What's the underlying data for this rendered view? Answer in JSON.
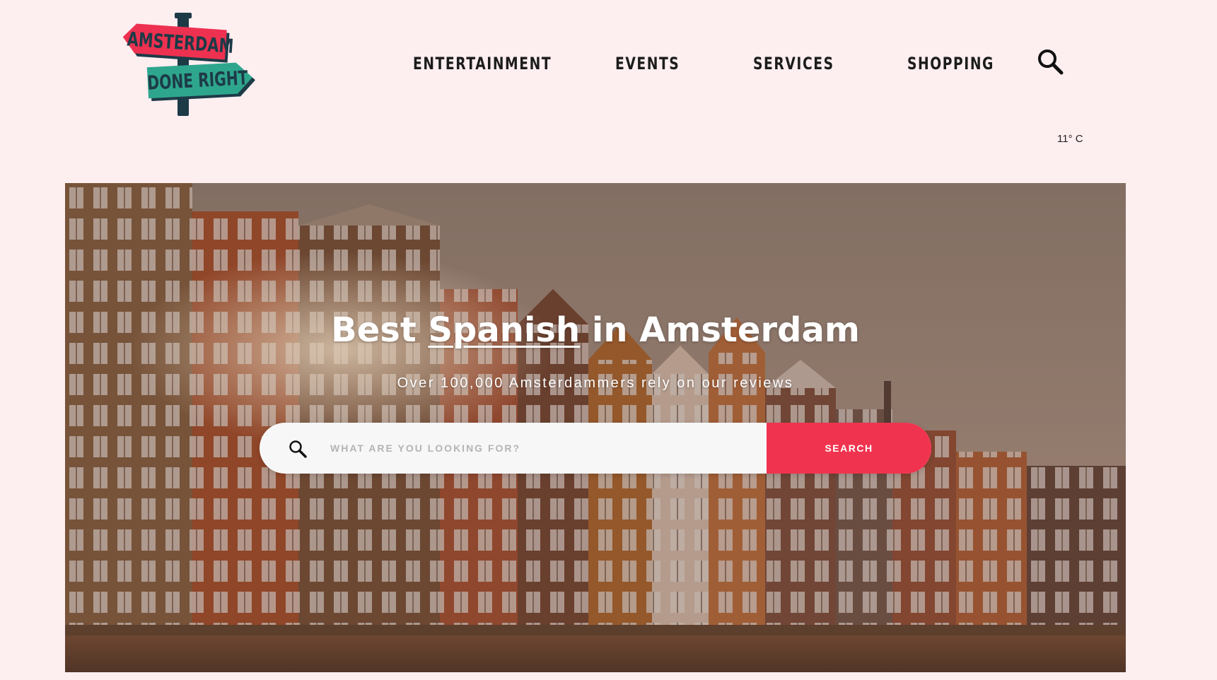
{
  "logo": {
    "line1": "AMSTERDAM",
    "line2": "DONE RIGHT",
    "colors": {
      "top_sign": "#ee3150",
      "bottom_sign": "#2ea68d",
      "post": "#1d3a47"
    }
  },
  "nav": {
    "items": [
      {
        "label": "ENTERTAINMENT"
      },
      {
        "label": "EVENTS"
      },
      {
        "label": "SERVICES"
      },
      {
        "label": "SHOPPING"
      }
    ],
    "search_icon": "search-icon"
  },
  "weather": {
    "text": "11° C"
  },
  "hero": {
    "title_before": "Best ",
    "title_highlight": "Spanish",
    "title_after": " in Amsterdam",
    "subtitle": "Over 100,000 Amsterdammers rely on our reviews",
    "search": {
      "placeholder": "WHAT ARE YOU LOOKING FOR?",
      "value": "",
      "button_label": "SEARCH",
      "icon": "search-icon"
    }
  },
  "colors": {
    "page_bg": "#fdeef0",
    "accent": "#f0344f",
    "text": "#1c1c1c"
  }
}
